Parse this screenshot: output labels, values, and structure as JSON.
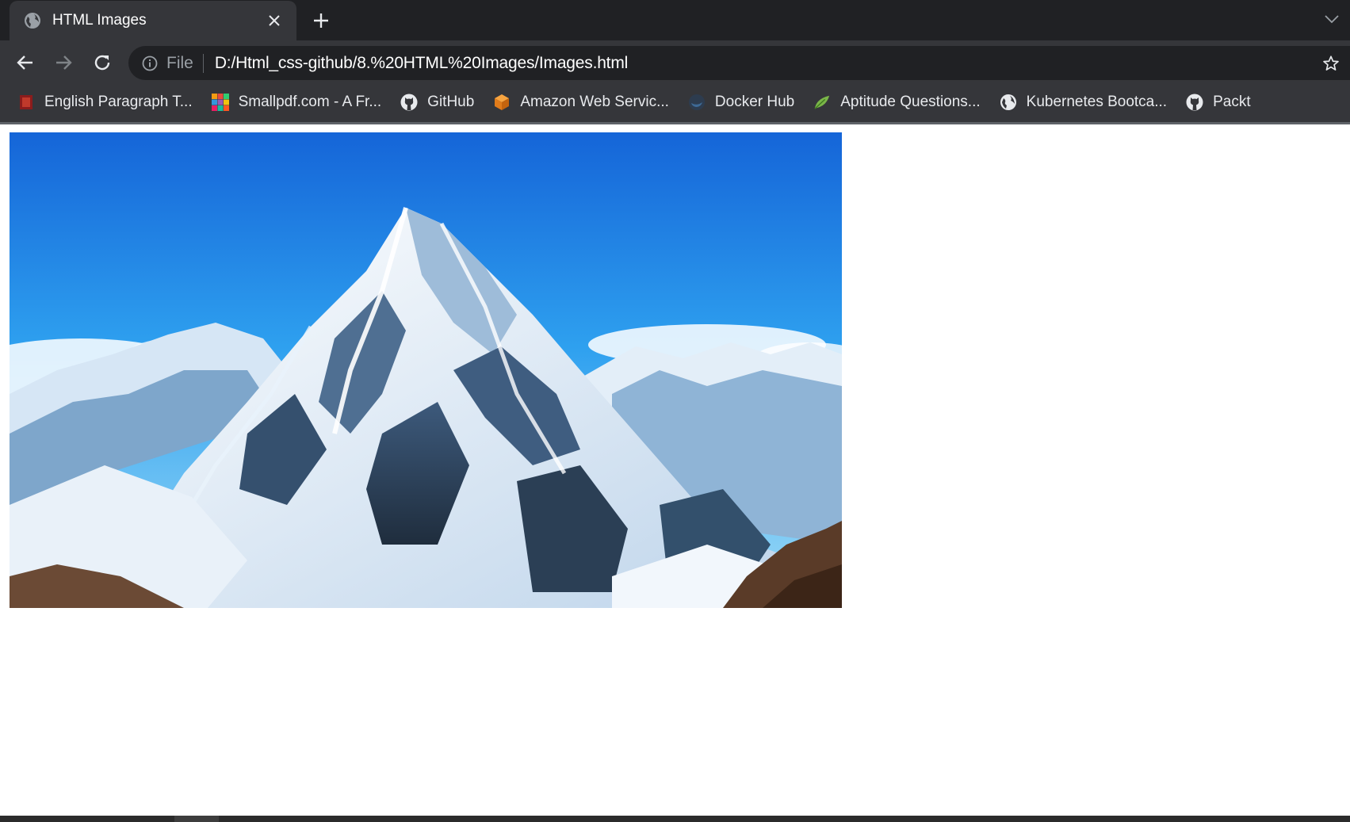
{
  "tab": {
    "title": "HTML Images",
    "favicon": "globe-icon"
  },
  "address_bar": {
    "scheme_label": "File",
    "url": "D:/Html_css-github/8.%20HTML%20Images/Images.html"
  },
  "bookmarks": [
    {
      "label": "English Paragraph T...",
      "icon": "red-square-icon"
    },
    {
      "label": "Smallpdf.com - A Fr...",
      "icon": "smallpdf-icon"
    },
    {
      "label": "GitHub",
      "icon": "github-icon"
    },
    {
      "label": "Amazon Web Servic...",
      "icon": "aws-cube-icon"
    },
    {
      "label": "Docker Hub",
      "icon": "docker-icon"
    },
    {
      "label": "Aptitude Questions...",
      "icon": "leaf-icon"
    },
    {
      "label": "Kubernetes Bootca...",
      "icon": "globe-icon"
    },
    {
      "label": "Packt",
      "icon": "github-icon"
    }
  ],
  "colors": {
    "tabstrip": "#202124",
    "toolbar": "#35363a",
    "sky_top": "#1a6fd6",
    "sky_bottom": "#8fd3f4"
  }
}
